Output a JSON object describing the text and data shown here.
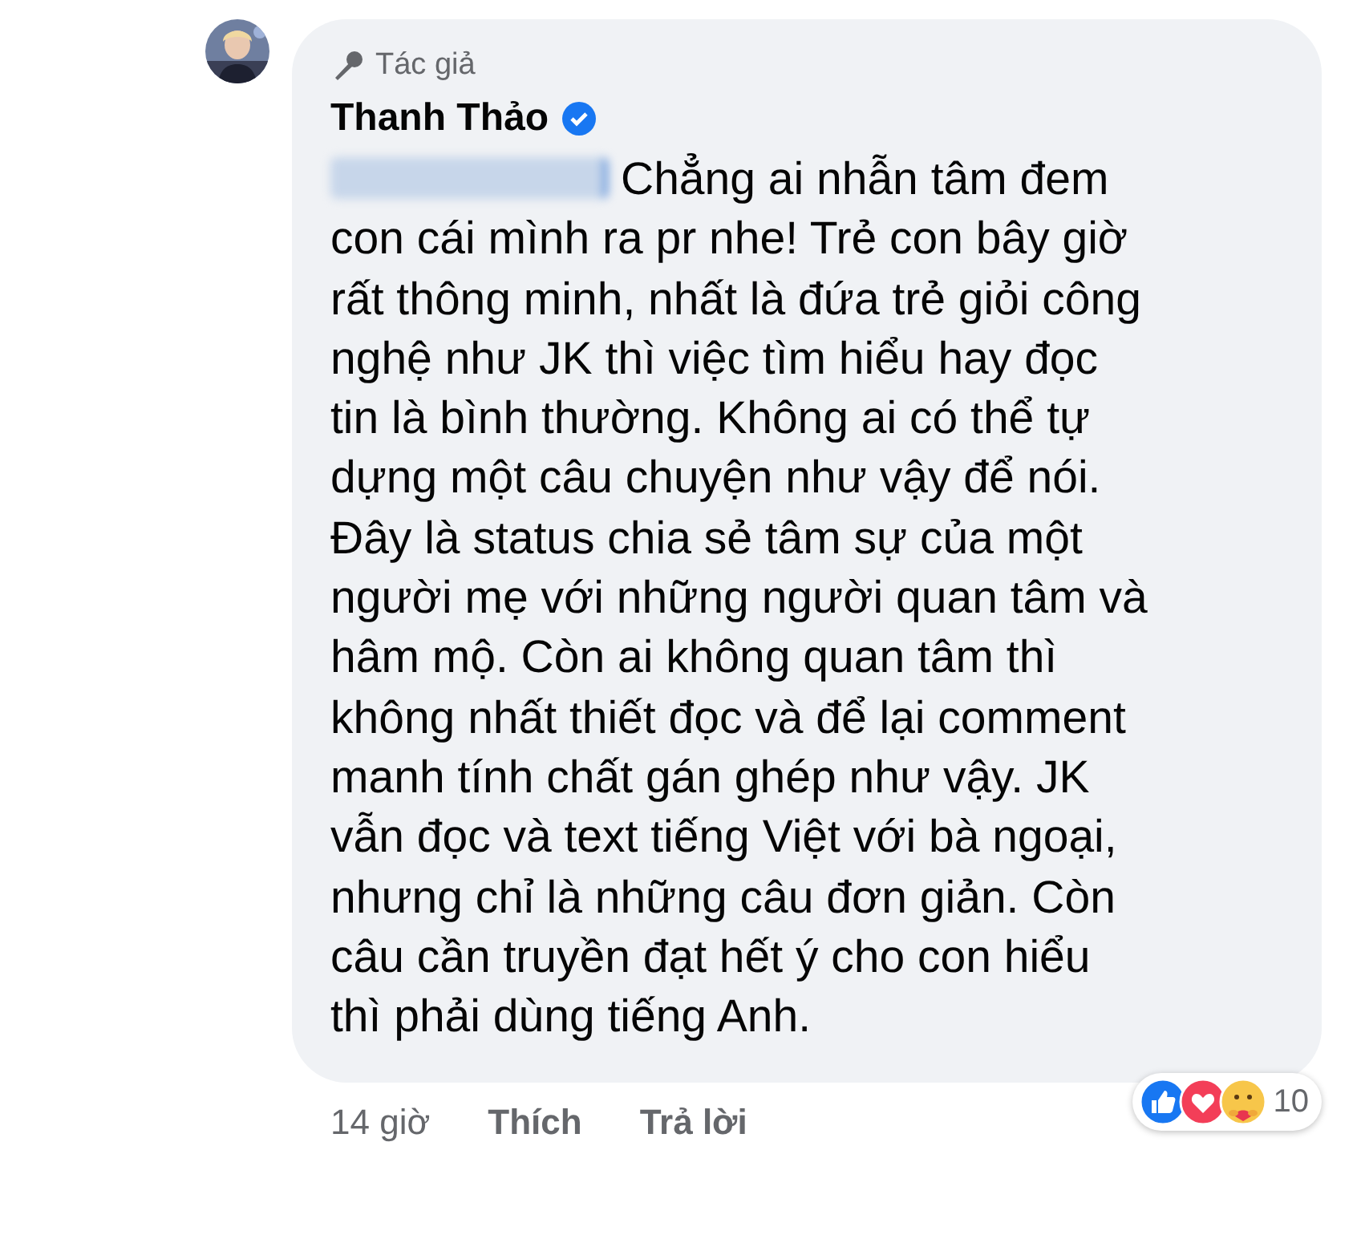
{
  "comment": {
    "badge": "Tác giả",
    "author": "Thanh Thảo",
    "verified": true,
    "mention_blurred": true,
    "text_lines": [
      "Chẳng ai nhẫn tâm đem",
      "con cái mình ra pr nhe! Trẻ con bây giờ",
      "rất thông minh, nhất là đứa trẻ giỏi công",
      "nghệ như JK thì việc tìm hiểu hay đọc",
      "tin là bình thường. Không ai có thể tự",
      "dựng một câu chuyện như vậy để nói.",
      "Đây là status chia sẻ tâm sự của một",
      "người mẹ với những người quan tâm và",
      "hâm mộ. Còn ai không quan tâm thì",
      "không nhất thiết đọc và để lại comment",
      "manh tính chất gán ghép như vậy. JK",
      "vẫn đọc và text tiếng Việt với bà ngoại,",
      "nhưng chỉ là những câu đơn giản. Còn",
      "câu cần truyền đạt hết ý cho con hiểu",
      "thì phải dùng tiếng Anh."
    ],
    "time": "14 giờ",
    "actions": [
      "Thích",
      "Trả lời"
    ],
    "reactions": [
      {
        "kind": "like"
      },
      {
        "kind": "love"
      },
      {
        "kind": "care"
      }
    ],
    "reaction_count": "10"
  }
}
